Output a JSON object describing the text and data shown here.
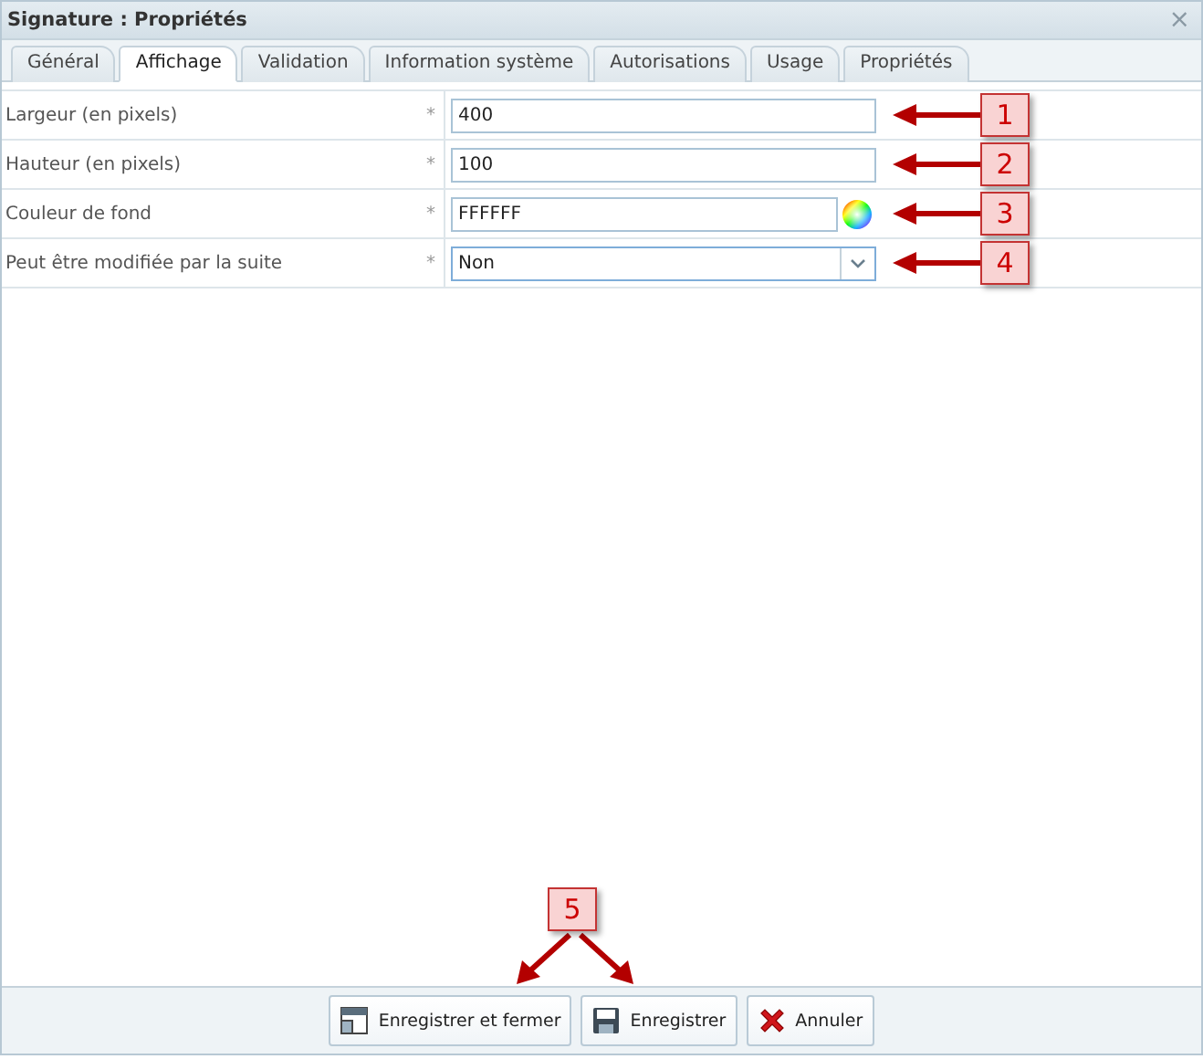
{
  "window": {
    "title": "Signature : Propriétés",
    "close": "×"
  },
  "tabs": [
    {
      "label": "Général",
      "selected": false
    },
    {
      "label": "Affichage",
      "selected": true
    },
    {
      "label": "Validation",
      "selected": false
    },
    {
      "label": "Information système",
      "selected": false
    },
    {
      "label": "Autorisations",
      "selected": false
    },
    {
      "label": "Usage",
      "selected": false
    },
    {
      "label": "Propriétés",
      "selected": false
    }
  ],
  "fields": [
    {
      "label": "Largeur (en pixels)",
      "required": "*",
      "kind": "text",
      "value": "400",
      "callout": "1"
    },
    {
      "label": "Hauteur (en pixels)",
      "required": "*",
      "kind": "text",
      "value": "100",
      "callout": "2"
    },
    {
      "label": "Couleur de fond",
      "required": "*",
      "kind": "color",
      "value": "FFFFFF",
      "callout": "3"
    },
    {
      "label": "Peut être modifiée par la suite",
      "required": "*",
      "kind": "select",
      "value": "Non",
      "callout": "4"
    }
  ],
  "footer_callout": "5",
  "buttons": [
    {
      "label": "Enregistrer et fermer",
      "kind": "save-close"
    },
    {
      "label": "Enregistrer",
      "kind": "save"
    },
    {
      "label": "Annuler",
      "kind": "cancel"
    }
  ]
}
